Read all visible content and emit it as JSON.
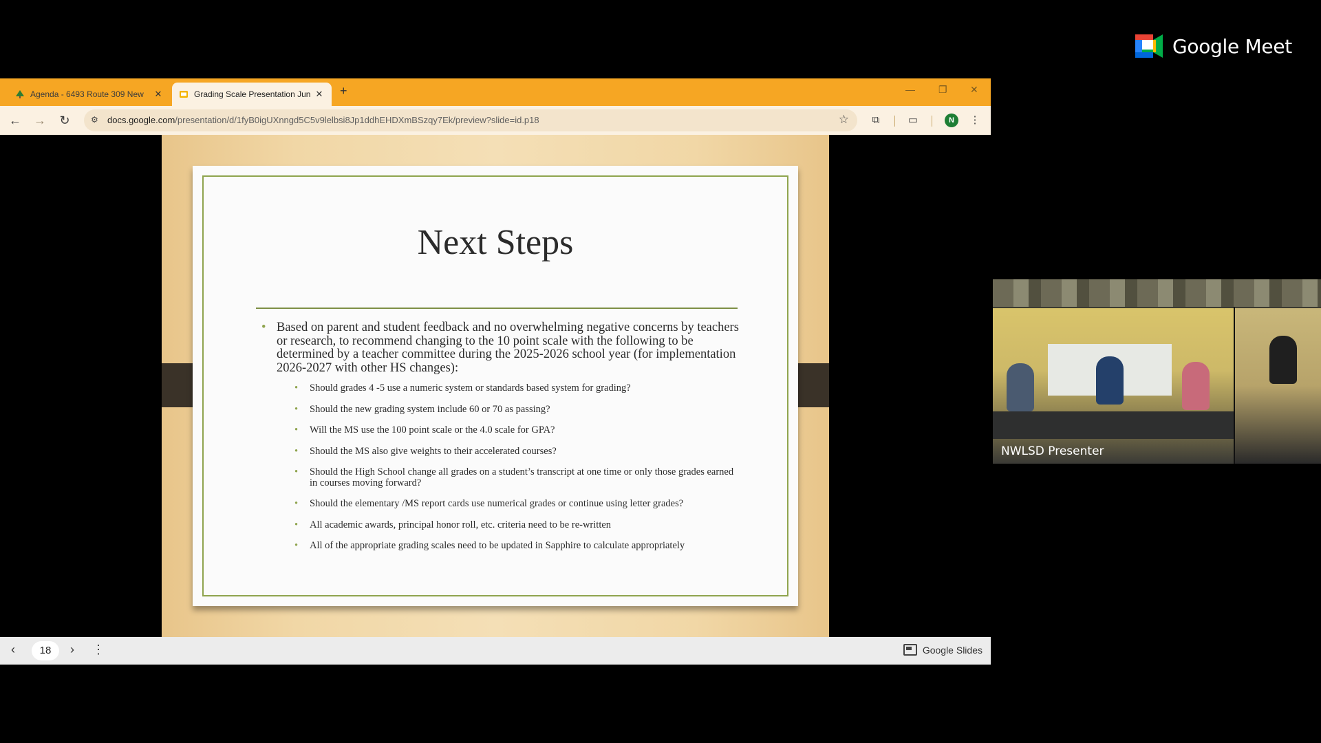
{
  "meet": {
    "logo_text": "Google Meet"
  },
  "browser": {
    "tabs": [
      {
        "title": "Agenda - 6493 Route 309 New",
        "active": false,
        "icon": "tree-favicon-icon"
      },
      {
        "title": "Grading Scale Presentation Jun",
        "active": true,
        "icon": "slides-favicon-icon"
      }
    ],
    "new_tab": "+",
    "url_host": "docs.google.com",
    "url_path": "/presentation/d/1fyB0igUXnngd5C5v9lelbsi8Jp1ddhEHDXmBSzqy7Ek/preview?slide=id.p18",
    "profile_initial": "N"
  },
  "slide": {
    "title": "Next Steps",
    "main_bullet": "Based on parent and student feedback and no overwhelming negative concerns by teachers or research, to recommend changing to the 10 point scale with the following to be determined by a teacher committee during the 2025-2026 school year (for implementation 2026-2027 with other HS changes):",
    "sub_bullets": [
      "Should grades 4 -5 use a numeric system or standards based system for grading?",
      "Should the new grading system include 60 or 70 as passing?",
      "Will the MS use the 100 point scale or the 4.0 scale for GPA?",
      "Should the MS also give weights to their accelerated courses?",
      "Should the High School change all grades on a student’s transcript at one time or only those grades earned in courses moving forward?",
      "Should the elementary /MS report cards use numerical grades or continue using letter grades?",
      "All academic awards, principal honor roll, etc. criteria need to be re-written",
      "All of the appropriate grading scales need to be updated in Sapphire to calculate appropriately"
    ],
    "bullet_glyph": "•",
    "accent_color": "#8fa44e"
  },
  "slidebar": {
    "page_number": "18",
    "app_label": "Google Slides"
  },
  "video": {
    "name": "NWLSD Presenter"
  }
}
